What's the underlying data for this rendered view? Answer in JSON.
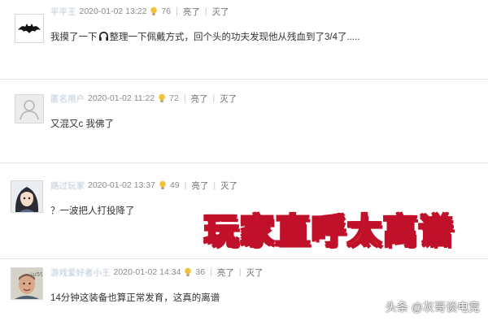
{
  "comments": [
    {
      "username": "平平王",
      "timestamp": "2020-01-02 13:22",
      "likes": "76",
      "like_label": "亮了",
      "dislike_label": "灭了",
      "text_before": "我摸了一下",
      "text_after": "整理一下佩戴方式，回个头的功夫发现他从残血到了3/4了....."
    },
    {
      "username": "匿名用户",
      "timestamp": "2020-01-02 11:22",
      "likes": "72",
      "like_label": "亮了",
      "dislike_label": "灭了",
      "text": "又混又c 我佛了"
    },
    {
      "username": "路过玩家",
      "timestamp": "2020-01-02 13:37",
      "likes": "49",
      "like_label": "亮了",
      "dislike_label": "灭了",
      "text": "？一波把人打投降了"
    },
    {
      "username": "游戏爱好者小王",
      "timestamp": "2020-01-02 14:34",
      "likes": "36",
      "like_label": "亮了",
      "dislike_label": "灭了",
      "text": "14分钟这装备也算正常发育，这真的离谱"
    }
  ],
  "overlay_title": "玩家直呼太离谱",
  "watermark": "头条 @灰哥谈电竞",
  "colors": {
    "overlay_fill": "#ffe600",
    "overlay_stroke": "#c0102a",
    "meta_text": "#8a8a8a",
    "separator": "#e6e6e6"
  }
}
